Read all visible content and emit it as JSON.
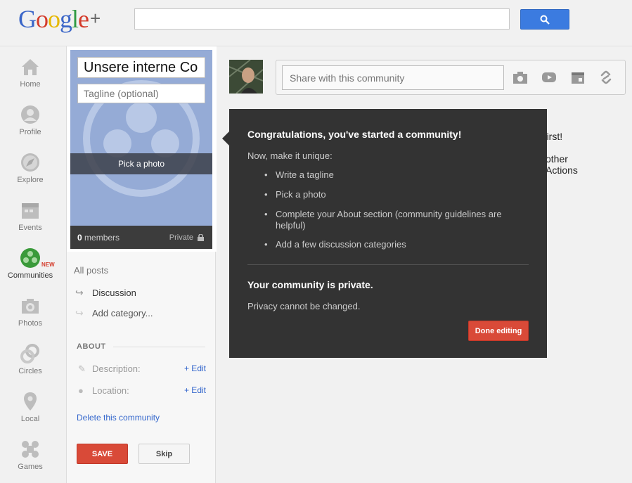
{
  "header": {
    "logo_text": "Google",
    "logo_plus": "+",
    "search_placeholder": "",
    "search_icon": "search-icon"
  },
  "nav": [
    {
      "label": "Home",
      "icon": "home-icon"
    },
    {
      "label": "Profile",
      "icon": "profile-icon"
    },
    {
      "label": "Explore",
      "icon": "compass-icon"
    },
    {
      "label": "Events",
      "icon": "calendar-icon"
    },
    {
      "label": "Communities",
      "icon": "communities-icon",
      "badge": "NEW"
    },
    {
      "label": "Photos",
      "icon": "camera-icon"
    },
    {
      "label": "Circles",
      "icon": "circles-icon"
    },
    {
      "label": "Local",
      "icon": "map-pin-icon"
    },
    {
      "label": "Games",
      "icon": "games-icon"
    }
  ],
  "community": {
    "name_value": "Unsere interne Co",
    "tagline_placeholder": "Tagline (optional)",
    "pick_photo": "Pick a photo",
    "members_count": "0",
    "members_label": " members",
    "privacy": "Private",
    "all_posts": "All posts",
    "categories": [
      "Discussion",
      "Add category..."
    ],
    "about_header": "ABOUT",
    "description_label": "Description:",
    "location_label": "Location:",
    "edit_label": "+ Edit",
    "delete_link": "Delete this community",
    "save_label": "SAVE",
    "skip_label": "Skip"
  },
  "stream": {
    "share_placeholder": "Share with this community",
    "behind_text": [
      "e first!",
      "other",
      "Actions"
    ]
  },
  "popup": {
    "title": "Congratulations, you've started a community!",
    "subtitle": "Now, make it unique:",
    "items": [
      "Write a tagline",
      "Pick a photo",
      "Complete your About section (community guidelines are helpful)",
      "Add a few discussion categories"
    ],
    "private_title": "Your community is private.",
    "privacy_note": "Privacy cannot be changed.",
    "done_label": "Done editing"
  },
  "colors": {
    "accent_red": "#d94a38",
    "accent_blue": "#3b7be0",
    "communities_green": "#3a9a3a",
    "popup_bg": "#333333",
    "cover_blue": "#95abd6"
  }
}
